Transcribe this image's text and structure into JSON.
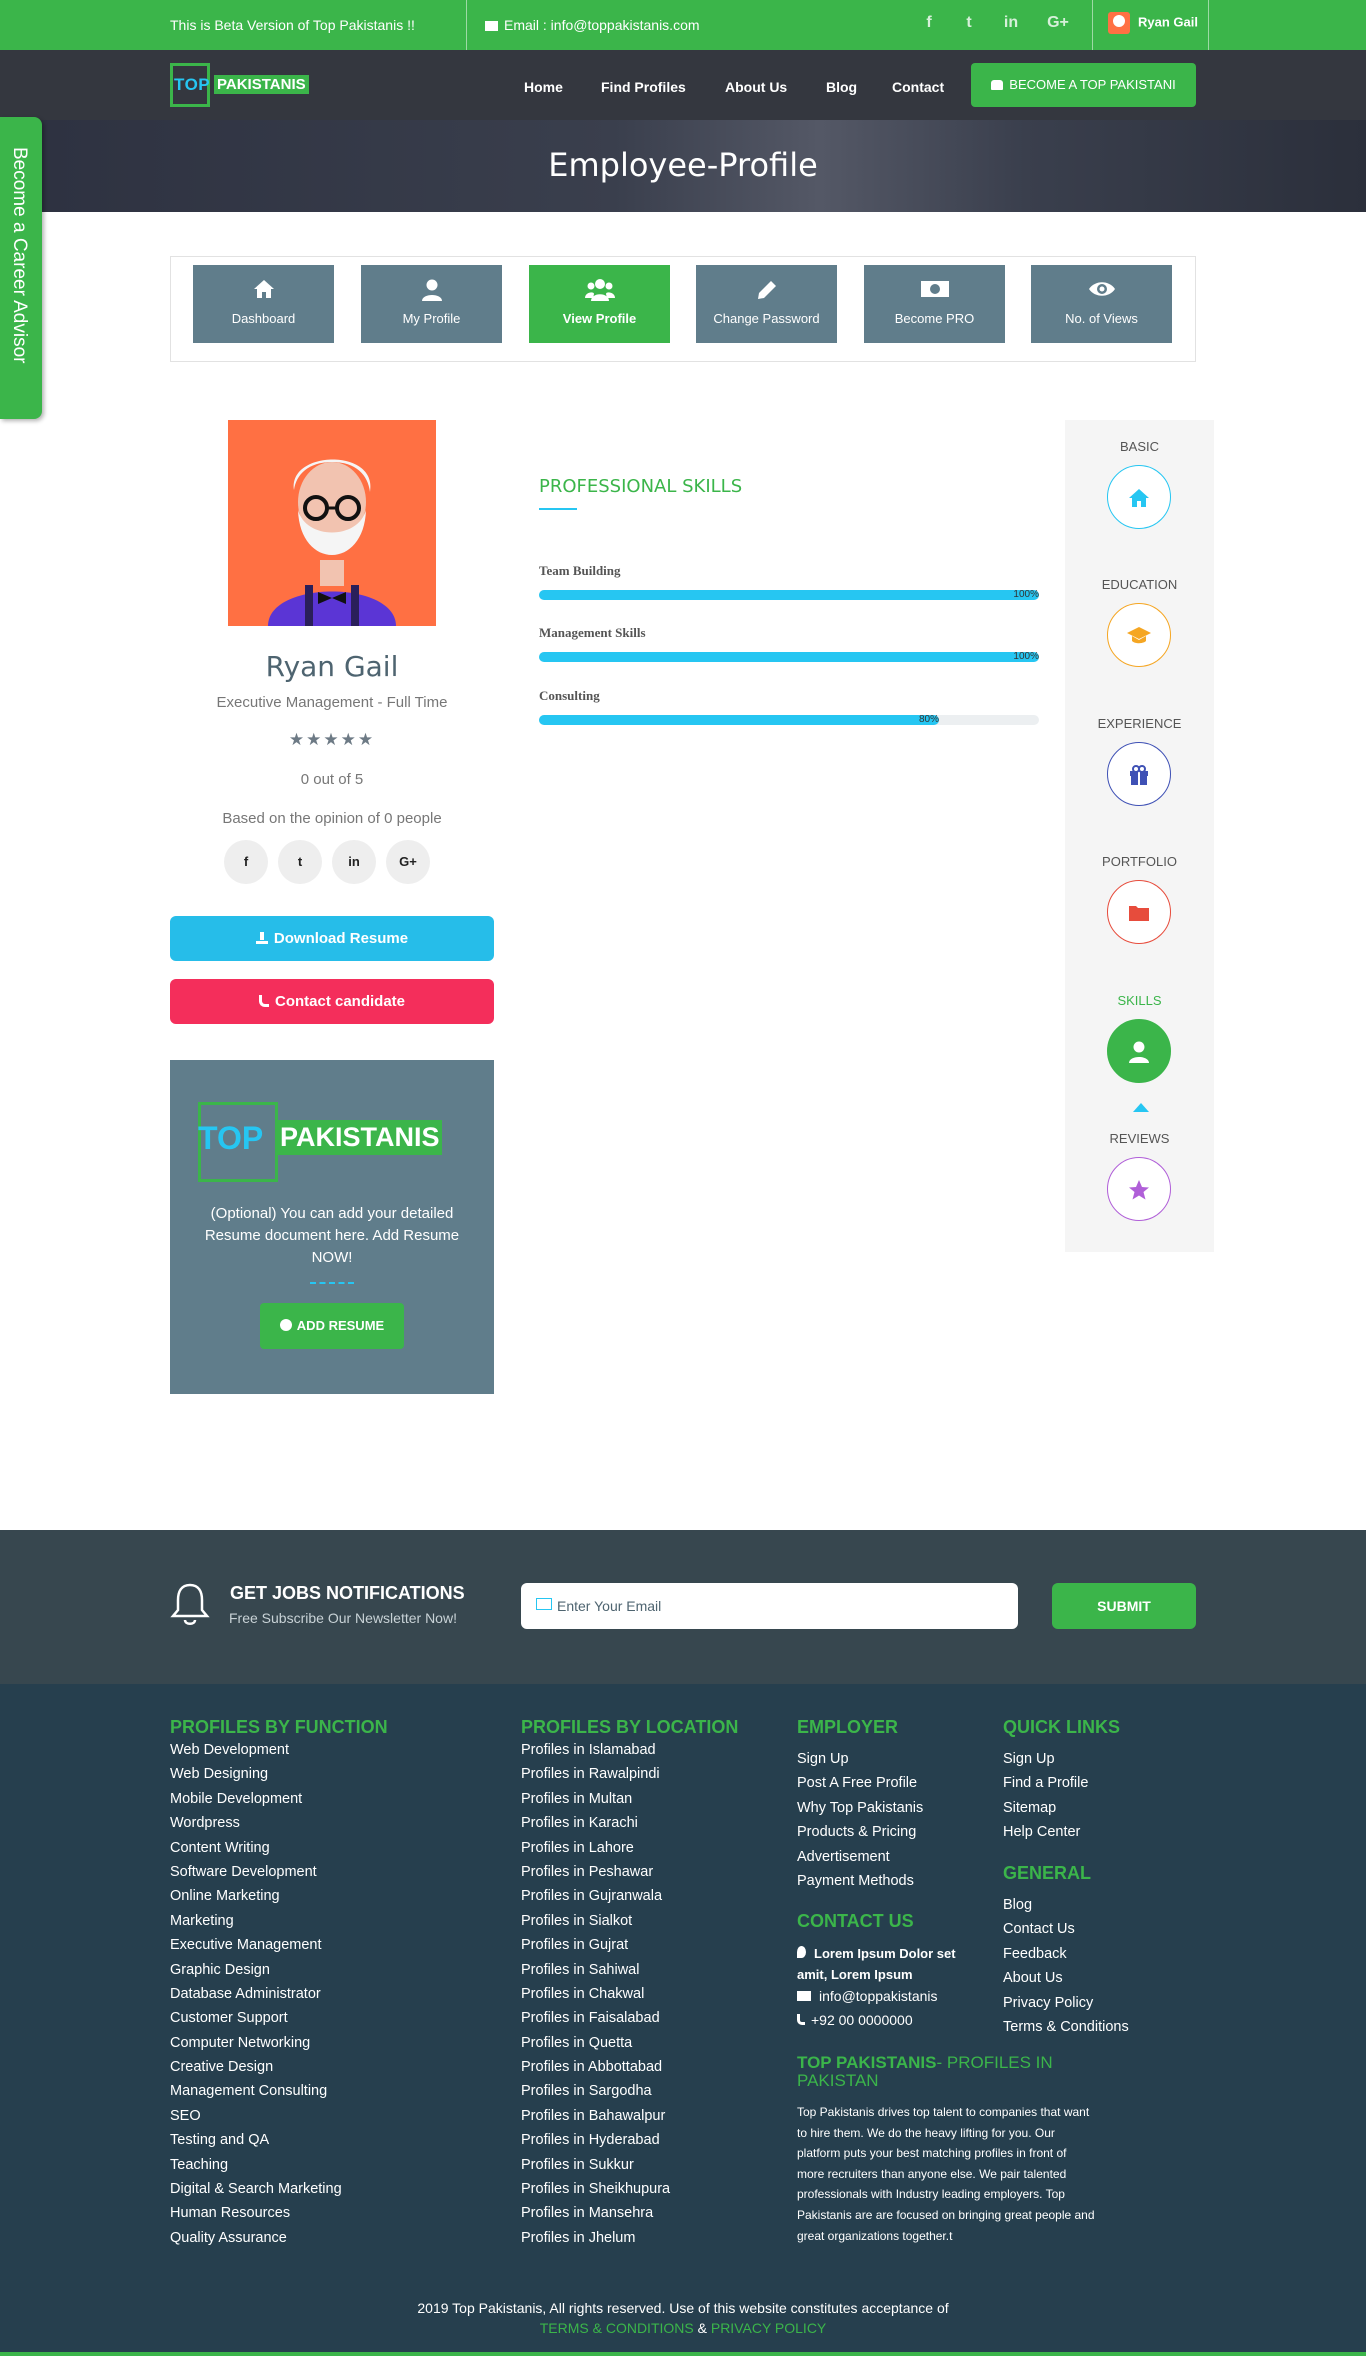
{
  "topbar": {
    "beta_text": "This is Beta Version of Top Pakistanis !!",
    "email_label": "Email : info@toppakistanis.com",
    "social": [
      "f",
      "t",
      "in",
      "G+"
    ],
    "user_name": "Ryan Gail"
  },
  "logo": {
    "part1": "TOP",
    "part2": "PAKISTANIS"
  },
  "nav": {
    "items": [
      "Home",
      "Find Profiles",
      "About Us",
      "Blog",
      "Contact"
    ],
    "cta": "BECOME A TOP PAKISTANI"
  },
  "banner": {
    "title": "Employee-Profile"
  },
  "side_tab": {
    "label": "Become a Career Advisor"
  },
  "dashboard_tabs": [
    "Dashboard",
    "My Profile",
    "View Profile",
    "Change Password",
    "Become PRO",
    "No. of Views"
  ],
  "profile": {
    "name": "Ryan Gail",
    "title": "Executive Management - Full Time",
    "stars": "★★★★★",
    "rating_text": "0 out of 5",
    "opinion_text": "Based on the opinion of 0 people",
    "social": [
      "f",
      "t",
      "in",
      "G+"
    ],
    "download_label": "Download Resume",
    "contact_label": "Contact candidate"
  },
  "resume_box": {
    "logo1": "TOP",
    "logo2": "PAKISTANIS",
    "text": "(Optional) You can add your detailed Resume document here. Add Resume NOW!",
    "button": "ADD RESUME"
  },
  "skills": {
    "title": "PROFESSIONAL SKILLS",
    "items": [
      {
        "name": "Team Building",
        "percent": 100,
        "label": "100%"
      },
      {
        "name": "Management Skills",
        "percent": 100,
        "label": "100%"
      },
      {
        "name": "Consulting",
        "percent": 80,
        "label": "80%"
      }
    ]
  },
  "right_nav": {
    "items": [
      {
        "label": "BASIC",
        "icon": "home-icon",
        "color": "#26c6f2"
      },
      {
        "label": "EDUCATION",
        "icon": "graduation-cap-icon",
        "color": "#f5a623"
      },
      {
        "label": "EXPERIENCE",
        "icon": "gift-icon",
        "color": "#3f51b5"
      },
      {
        "label": "PORTFOLIO",
        "icon": "folder-icon",
        "color": "#e74c3c"
      },
      {
        "label": "SKILLS",
        "icon": "user-icon",
        "color": "#3bb54a"
      },
      {
        "label": "REVIEWS",
        "icon": "star-icon",
        "color": "#b05fd8"
      }
    ]
  },
  "newsletter": {
    "heading": "GET JOBS NOTIFICATIONS",
    "sub": "Free Subscribe Our Newsletter Now!",
    "placeholder": "Enter Your Email",
    "submit": "SUBMIT"
  },
  "footer": {
    "function_title": "PROFILES BY FUNCTION",
    "function_items": [
      "Web Development",
      "Web Designing",
      "Mobile Development",
      "Wordpress",
      "Content Writing",
      "Software Development",
      "Online Marketing",
      "Marketing",
      "Executive Management",
      "Graphic Design",
      "Database Administrator",
      "Customer Support",
      "Computer Networking",
      "Creative Design",
      "Management Consulting",
      "SEO",
      "Testing and QA",
      "Teaching",
      "Digital & Search Marketing",
      "Human Resources",
      "Quality Assurance"
    ],
    "location_title": "PROFILES BY LOCATION",
    "location_items": [
      "Profiles in Islamabad",
      "Profiles in Rawalpindi",
      "Profiles in Multan",
      "Profiles in Karachi",
      "Profiles in Lahore",
      "Profiles in Peshawar",
      "Profiles in Gujranwala",
      "Profiles in Sialkot",
      "Profiles in Gujrat",
      "Profiles in Sahiwal",
      "Profiles in Chakwal",
      "Profiles in Faisalabad",
      "Profiles in Quetta",
      "Profiles in Abbottabad",
      "Profiles in Sargodha",
      "Profiles in Bahawalpur",
      "Profiles in Hyderabad",
      "Profiles in Sukkur",
      "Profiles in Sheikhupura",
      "Profiles in Mansehra",
      "Profiles in Jhelum"
    ],
    "employer_title": "EMPLOYER",
    "employer_items": [
      "Sign Up",
      "Post A Free Profile",
      "Why Top Pakistanis",
      "Products & Pricing",
      "Advertisement",
      "Payment Methods"
    ],
    "contact_title": "CONTACT US",
    "contact_address": "Lorem Ipsum Dolor set amit, Lorem Ipsum",
    "contact_email": "info@toppakistanis",
    "contact_phone": "+92 00 0000000",
    "about_title_1": "TOP PAKISTANIS",
    "about_title_2": "- PROFILES IN PAKISTAN",
    "about_text": "Top Pakistanis drives top talent to companies that want to hire them. We do the heavy lifting for you. Our platform puts your best matching profiles in front of more recruiters than anyone else. We pair talented professionals with Industry leading employers. Top Pakistanis are are focused on bringing great people and great organizations together.t",
    "quick_title": "QUICK LINKS",
    "quick_items": [
      "Sign Up",
      "Find a Profile",
      "Sitemap",
      "Help Center"
    ],
    "general_title": "GENERAL",
    "general_items": [
      "Blog",
      "Contact Us",
      "Feedback",
      "About Us",
      "Privacy Policy",
      "Terms & Conditions"
    ],
    "copyright": "2019 Top Pakistanis, All rights reserved. Use of this website constitutes acceptance of",
    "terms": "TERMS & CONDITIONS",
    "and": "&",
    "privacy": "PRIVACY POLICY"
  }
}
